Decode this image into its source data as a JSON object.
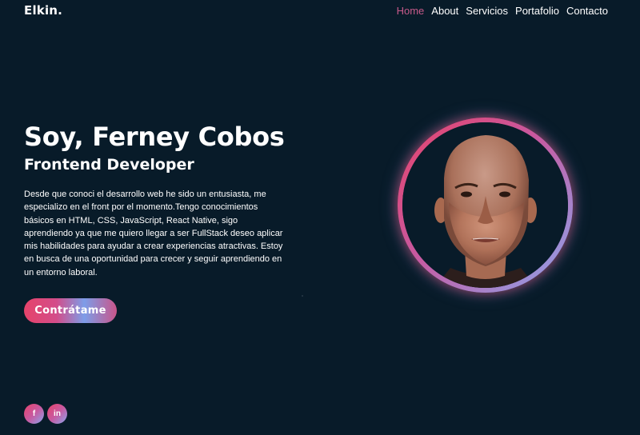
{
  "header": {
    "logo": "Elkin.",
    "nav": [
      {
        "label": "Home",
        "active": true
      },
      {
        "label": "About",
        "active": false
      },
      {
        "label": "Servicios",
        "active": false
      },
      {
        "label": "Portafolio",
        "active": false
      },
      {
        "label": "Contacto",
        "active": false
      }
    ]
  },
  "hero": {
    "title": "Soy, Ferney Cobos",
    "subtitle": "Frontend Developer",
    "description": "Desde que conoci el desarrollo web he sido un entusiasta, me especializo en el front por el momento.Tengo conocimientos básicos en HTML, CSS, JavaScript, React Native, sigo aprendiendo ya que me quiero llegar a ser FullStack deseo aplicar mis habilidades para ayudar a crear experiencias atractivas. Estoy en busca de una oportunidad para crecer y seguir aprendiendo en un entorno laboral.",
    "cta_label": "Contrátame"
  },
  "socials": [
    {
      "icon": "facebook-icon",
      "glyph": "f"
    },
    {
      "icon": "linkedin-icon",
      "glyph": "in"
    }
  ],
  "colors": {
    "background": "#081b29",
    "accent_pink": "#e6436a",
    "accent_blue": "#8ba6ee",
    "nav_active": "#c75a8a"
  }
}
